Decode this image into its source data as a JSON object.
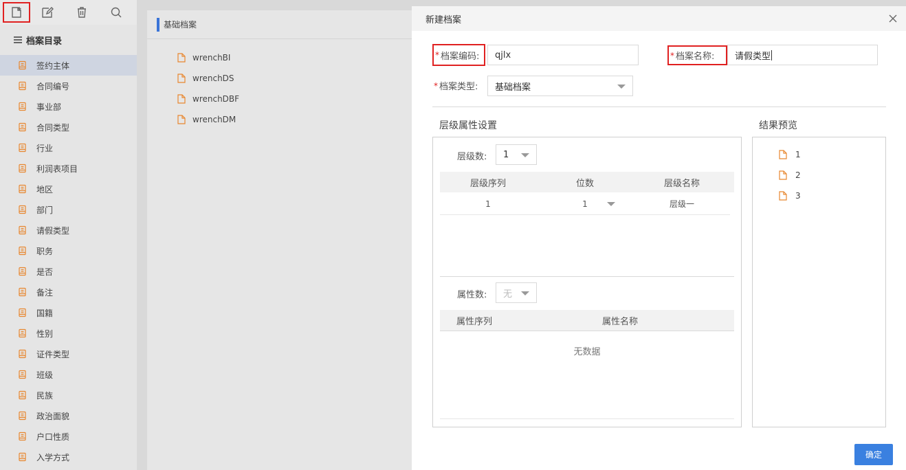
{
  "sidebar": {
    "catalog_title": "档案目录",
    "items": [
      {
        "label": "签约主体"
      },
      {
        "label": "合同编号"
      },
      {
        "label": "事业部"
      },
      {
        "label": "合同类型"
      },
      {
        "label": "行业"
      },
      {
        "label": "利润表项目"
      },
      {
        "label": "地区"
      },
      {
        "label": "部门"
      },
      {
        "label": "请假类型"
      },
      {
        "label": "职务"
      },
      {
        "label": "是否"
      },
      {
        "label": "备注"
      },
      {
        "label": "国籍"
      },
      {
        "label": "性别"
      },
      {
        "label": "证件类型"
      },
      {
        "label": "班级"
      },
      {
        "label": "民族"
      },
      {
        "label": "政治面貌"
      },
      {
        "label": "户口性质"
      },
      {
        "label": "入学方式"
      }
    ]
  },
  "middle": {
    "header": "基础档案",
    "files": [
      "wrenchBI",
      "wrenchDS",
      "wrenchDBF",
      "wrenchDM"
    ]
  },
  "modal": {
    "title": "新建档案",
    "required_mark": "*",
    "code_label": "档案编码:",
    "code_value": "qjlx",
    "name_label": "档案名称:",
    "name_value": "请假类型",
    "type_label": "档案类型:",
    "type_value": "基础档案",
    "level_section_title": "层级属性设置",
    "preview_title": "结果预览",
    "level_count_label": "层级数:",
    "level_count_value": "1",
    "level_table": {
      "headers": [
        "层级序列",
        "位数",
        "层级名称"
      ],
      "rows": [
        [
          "1",
          "1",
          "层级一"
        ]
      ]
    },
    "attr_count_label": "属性数:",
    "attr_count_value": "无",
    "attr_table": {
      "headers": [
        "属性序列",
        "属性名称"
      ],
      "empty_text": "无数据"
    },
    "preview_items": [
      "1",
      "2",
      "3"
    ],
    "confirm_label": "确定"
  },
  "colors": {
    "accent": "#3a80e0",
    "highlight_border": "#e02020",
    "file_icon": "#e8872f"
  }
}
